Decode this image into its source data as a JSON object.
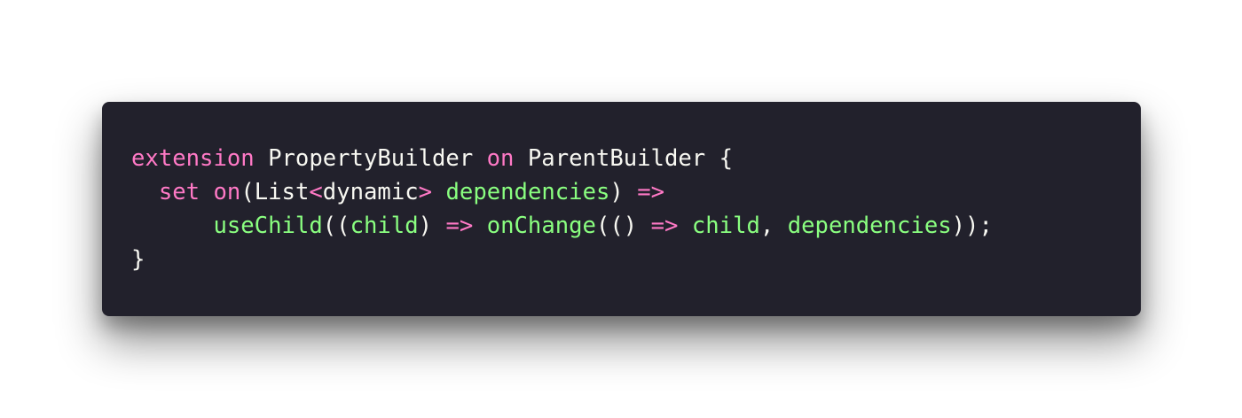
{
  "code": {
    "line1": {
      "t1": "extension",
      "t2": " PropertyBuilder ",
      "t3": "on",
      "t4": " ParentBuilder {"
    },
    "line2": {
      "t1": "  ",
      "t2": "set",
      "t3": " ",
      "t4": "on",
      "t5": "(List",
      "t6": "<",
      "t7": "dynamic",
      "t8": ">",
      "t9": " ",
      "t10": "dependencies",
      "t11": ") ",
      "t12": "=>"
    },
    "line3": {
      "t1": "      ",
      "t2": "useChild",
      "t3": "((",
      "t4": "child",
      "t5": ") ",
      "t6": "=>",
      "t7": " ",
      "t8": "onChange",
      "t9": "(() ",
      "t10": "=>",
      "t11": " ",
      "t12": "child",
      "t13": ", ",
      "t14": "dependencies",
      "t15": "));"
    },
    "line4": {
      "t1": "}"
    }
  },
  "colors": {
    "background": "#22212c",
    "keyword": "#ff79c6",
    "function": "#8aff80",
    "text": "#f8f8f2"
  }
}
